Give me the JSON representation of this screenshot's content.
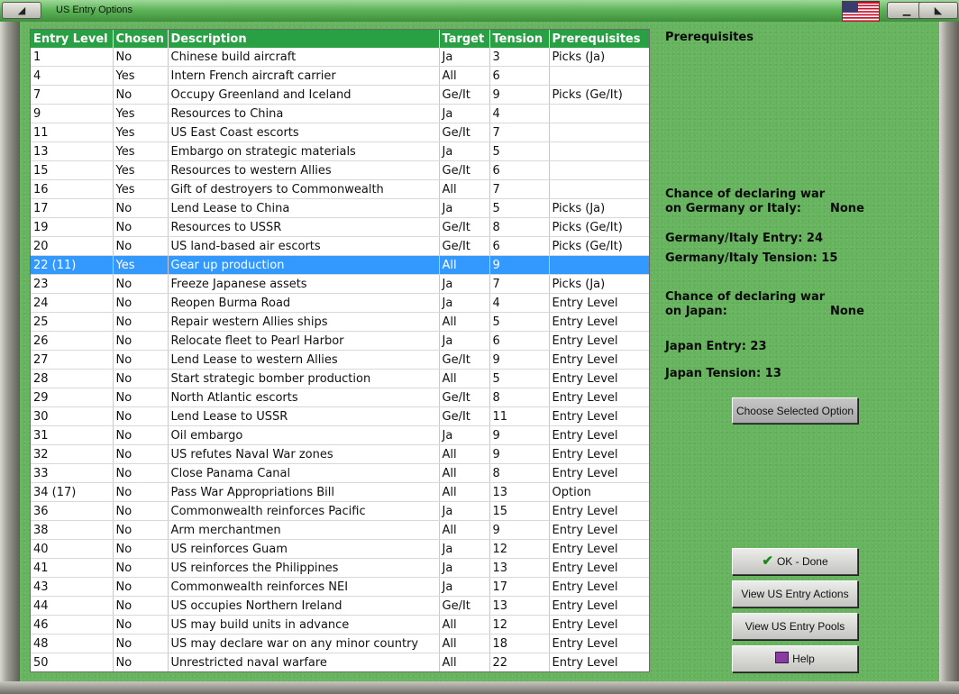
{
  "window": {
    "title": "US Entry Options"
  },
  "table": {
    "headers": [
      "Entry Level",
      "Chosen",
      "Description",
      "Target",
      "Tension",
      "Prerequisites"
    ],
    "rows": [
      [
        "1",
        "No",
        "Chinese build aircraft",
        "Ja",
        "3",
        "Picks (Ja)"
      ],
      [
        "4",
        "Yes",
        "Intern French aircraft carrier",
        "All",
        "6",
        ""
      ],
      [
        "7",
        "No",
        "Occupy Greenland and Iceland",
        "Ge/It",
        "9",
        "Picks (Ge/It)"
      ],
      [
        "9",
        "Yes",
        "Resources to China",
        "Ja",
        "4",
        ""
      ],
      [
        "11",
        "Yes",
        "US East Coast escorts",
        "Ge/It",
        "7",
        ""
      ],
      [
        "13",
        "Yes",
        "Embargo on strategic materials",
        "Ja",
        "5",
        ""
      ],
      [
        "15",
        "Yes",
        "Resources to western Allies",
        "Ge/It",
        "6",
        ""
      ],
      [
        "16",
        "Yes",
        "Gift of destroyers to Commonwealth",
        "All",
        "7",
        ""
      ],
      [
        "17",
        "No",
        "Lend Lease to China",
        "Ja",
        "5",
        "Picks (Ja)"
      ],
      [
        "19",
        "No",
        "Resources to USSR",
        "Ge/It",
        "8",
        "Picks (Ge/It)"
      ],
      [
        "20",
        "No",
        "US land-based air escorts",
        "Ge/It",
        "6",
        "Picks (Ge/It)"
      ],
      [
        "22 (11)",
        "Yes",
        "Gear up production",
        "All",
        "9",
        ""
      ],
      [
        "23",
        "No",
        "Freeze Japanese assets",
        "Ja",
        "7",
        "Picks (Ja)"
      ],
      [
        "24",
        "No",
        "Reopen Burma Road",
        "Ja",
        "4",
        "Entry Level"
      ],
      [
        "25",
        "No",
        "Repair western Allies ships",
        "All",
        "5",
        "Entry Level"
      ],
      [
        "26",
        "No",
        "Relocate fleet to Pearl Harbor",
        "Ja",
        "6",
        "Entry Level"
      ],
      [
        "27",
        "No",
        "Lend Lease to western Allies",
        "Ge/It",
        "9",
        "Entry Level"
      ],
      [
        "28",
        "No",
        "Start strategic bomber production",
        "All",
        "5",
        "Entry Level"
      ],
      [
        "29",
        "No",
        "North Atlantic escorts",
        "Ge/It",
        "8",
        "Entry Level"
      ],
      [
        "30",
        "No",
        "Lend Lease to USSR",
        "Ge/It",
        "11",
        "Entry Level"
      ],
      [
        "31",
        "No",
        "Oil embargo",
        "Ja",
        "9",
        "Entry Level"
      ],
      [
        "32",
        "No",
        "US refutes Naval War zones",
        "All",
        "9",
        "Entry Level"
      ],
      [
        "33",
        "No",
        "Close Panama Canal",
        "All",
        "8",
        "Entry Level"
      ],
      [
        "34 (17)",
        "No",
        "Pass War Appropriations Bill",
        "All",
        "13",
        "Option"
      ],
      [
        "36",
        "No",
        "Commonwealth reinforces Pacific",
        "Ja",
        "15",
        "Entry Level"
      ],
      [
        "38",
        "No",
        "Arm merchantmen",
        "All",
        "9",
        "Entry Level"
      ],
      [
        "40",
        "No",
        "US reinforces Guam",
        "Ja",
        "12",
        "Entry Level"
      ],
      [
        "41",
        "No",
        "US reinforces the Philippines",
        "Ja",
        "13",
        "Entry Level"
      ],
      [
        "43",
        "No",
        "Commonwealth reinforces NEI",
        "Ja",
        "17",
        "Entry Level"
      ],
      [
        "44",
        "No",
        "US occupies Northern Ireland",
        "Ge/It",
        "13",
        "Entry Level"
      ],
      [
        "46",
        "No",
        "US may build units in advance",
        "All",
        "12",
        "Entry Level"
      ],
      [
        "48",
        "No",
        "US may declare war on any minor country",
        "All",
        "18",
        "Entry Level"
      ],
      [
        "50",
        "No",
        "Unrestricted naval warfare",
        "All",
        "22",
        "Entry Level"
      ]
    ],
    "selected_index": 11
  },
  "side": {
    "prereq_heading": "Prerequisites",
    "ge_chance_line1": "Chance of declaring war",
    "ge_chance_line2": "on Germany or Italy:",
    "ge_chance_value": "None",
    "ge_entry": "Germany/Italy Entry: 24",
    "ge_tension": "Germany/Italy Tension: 15",
    "ja_chance_line1": "Chance of declaring war",
    "ja_chance_line2": "on Japan:",
    "ja_chance_value": "None",
    "ja_entry": "Japan Entry: 23",
    "ja_tension": "Japan Tension: 13"
  },
  "buttons": {
    "choose": "Choose Selected Option",
    "ok": "OK - Done",
    "view_actions": "View US Entry Actions",
    "view_pools": "View US Entry Pools",
    "help": "Help"
  },
  "colors": {
    "header": "#2aa045",
    "selected": "#3399ff",
    "felt": "#66b45e"
  }
}
